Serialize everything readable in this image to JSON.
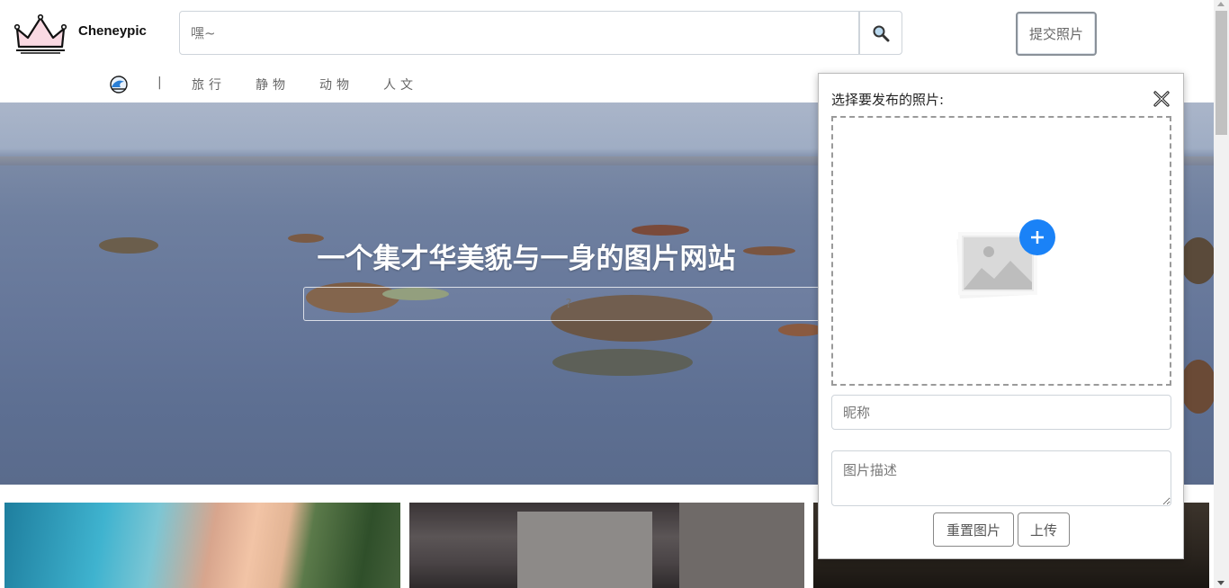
{
  "header": {
    "brand": "Cheneypic",
    "search_placeholder": "嘿~",
    "submit_label": "提交照片"
  },
  "nav": {
    "separator": "|",
    "items": [
      {
        "label": "旅行"
      },
      {
        "label": "静物"
      },
      {
        "label": "动物"
      },
      {
        "label": "人文"
      }
    ]
  },
  "hero": {
    "title": "一个集才华美貌与一身的图片网站",
    "search_placeholder": "?"
  },
  "upload_popup": {
    "title": "选择要发布的照片:",
    "nickname_placeholder": "昵称",
    "description_placeholder": "图片描述",
    "reset_label": "重置图片",
    "upload_label": "上传"
  },
  "colors": {
    "accent": "#1a82f7",
    "logo_pink": "#f9d9e2"
  },
  "icons": {
    "logo": "crown-logo-icon",
    "search": "magnifier-icon",
    "nav_logo": "wave-icon",
    "close": "close-icon",
    "add_photo": "add-image-icon"
  }
}
